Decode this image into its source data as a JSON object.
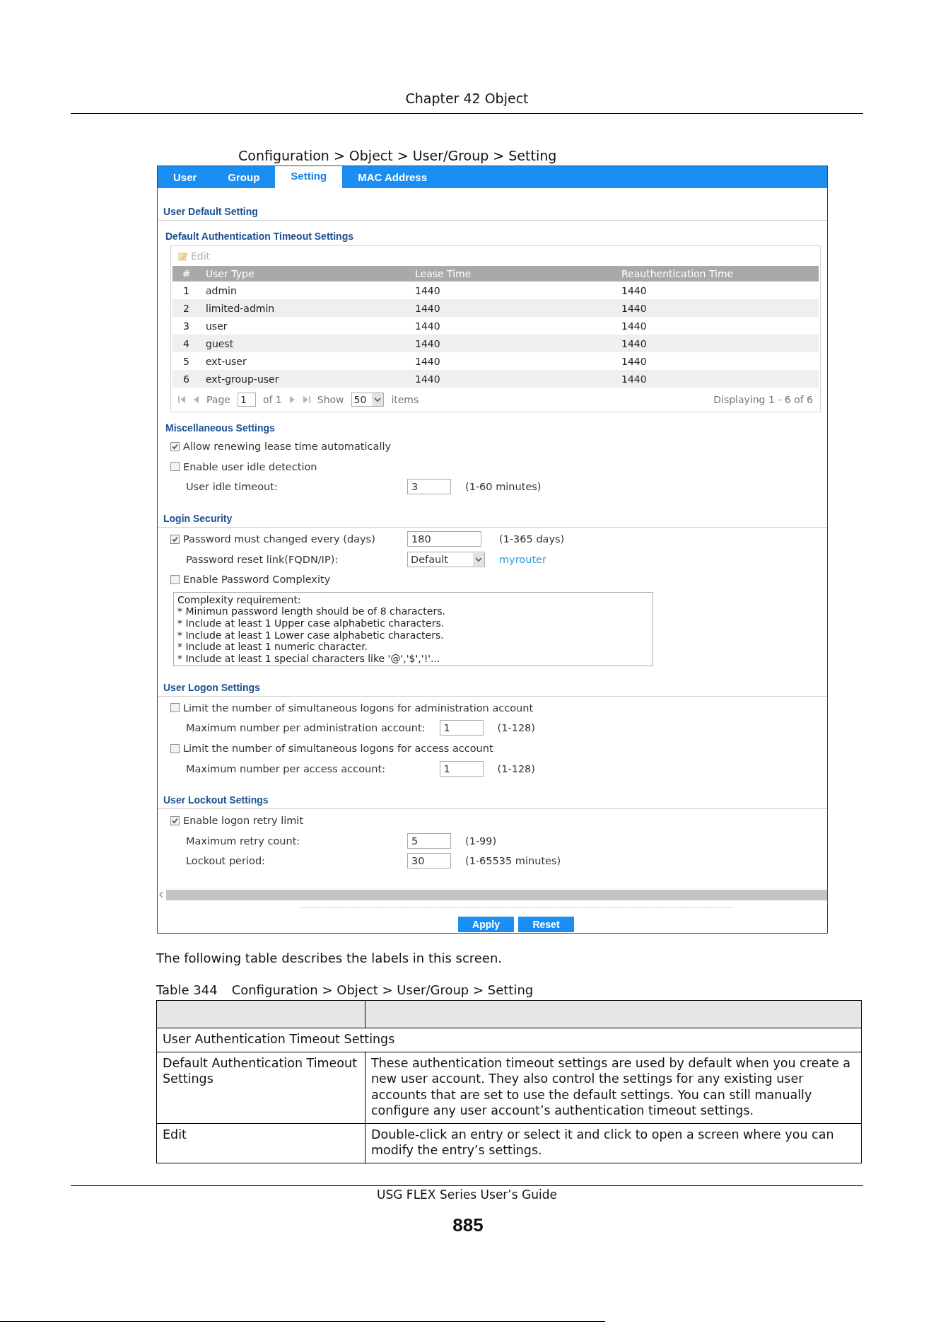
{
  "page_header": {
    "title": "Chapter 42 Object"
  },
  "figure": {
    "caption": "Configuration > Object > User/Group > Setting"
  },
  "screen": {
    "tabs": [
      {
        "label": "User",
        "selected": false
      },
      {
        "label": "Group",
        "selected": false
      },
      {
        "label": "Setting",
        "selected": true
      },
      {
        "label": "MAC Address",
        "selected": false
      }
    ],
    "blocks": [
      {
        "kind": "section",
        "title": "User Default Setting"
      },
      {
        "kind": "subsection",
        "title": "Default Authentication Timeout Settings"
      },
      {
        "kind": "table",
        "edit_button": {
          "label": "Edit",
          "disabled": true
        },
        "columns": [
          "#",
          "User Type",
          "Lease Time",
          "Reauthentication Time"
        ],
        "rows": [
          [
            "1",
            "admin",
            "1440",
            "1440"
          ],
          [
            "2",
            "limited-admin",
            "1440",
            "1440"
          ],
          [
            "3",
            "user",
            "1440",
            "1440"
          ],
          [
            "4",
            "guest",
            "1440",
            "1440"
          ],
          [
            "5",
            "ext-user",
            "1440",
            "1440"
          ],
          [
            "6",
            "ext-group-user",
            "1440",
            "1440"
          ]
        ],
        "pager": {
          "page_label": "Page",
          "page": "1",
          "page_total": "of 1",
          "show_label": "Show",
          "per_page": "50",
          "items_label": "items",
          "summary": "Displaying 1 - 6 of 6"
        }
      },
      {
        "kind": "subsection",
        "title": "Miscellaneous Settings"
      },
      {
        "kind": "group",
        "rows": [
          {
            "kind": "checkbox",
            "label": "Allow renewing lease time automatically",
            "checked": true
          },
          {
            "kind": "checkbox",
            "label": "Enable user idle detection",
            "checked": false
          },
          {
            "kind": "field",
            "label": "User idle timeout:",
            "value": "3",
            "hint": "(1-60 minutes)"
          }
        ]
      },
      {
        "kind": "section",
        "title": "Login Security"
      },
      {
        "kind": "group",
        "rows": [
          {
            "kind": "checkbox",
            "label": "Password must changed every (days)",
            "checked": true,
            "value": "180",
            "hint": "(1-365 days)"
          },
          {
            "kind": "select",
            "label": "Password reset link(FQDN/IP):",
            "value": "Default",
            "link": "myrouter"
          },
          {
            "kind": "checkbox",
            "label": "Enable Password Complexity",
            "checked": false
          },
          {
            "kind": "textarea",
            "lines": [
              "Complexity requirement:",
              "* Minimun password length should be of 8 characters.",
              "* Include at least 1 Upper case alphabetic characters.",
              "* Include at least 1 Lower case alphabetic characters.",
              "* Include at least 1 numeric character.",
              "* Include at least 1 special characters like '@','$','!'..."
            ]
          }
        ]
      },
      {
        "kind": "section",
        "title": "User Logon Settings"
      },
      {
        "kind": "group",
        "rows": [
          {
            "kind": "checkbox",
            "label": "Limit the number of simultaneous logons for administration account",
            "checked": false
          },
          {
            "kind": "field",
            "label": "Maximum number per administration account:",
            "value": "1",
            "hint": "(1-128)"
          },
          {
            "kind": "checkbox",
            "label": "Limit the number of simultaneous logons for access account",
            "checked": false
          },
          {
            "kind": "field",
            "label": "Maximum number per access account:",
            "value": "1",
            "hint": "(1-128)"
          }
        ]
      },
      {
        "kind": "section",
        "title": "User Lockout Settings"
      },
      {
        "kind": "group",
        "rows": [
          {
            "kind": "checkbox",
            "label": "Enable logon retry limit",
            "checked": true
          },
          {
            "kind": "field",
            "label": "Maximum retry count:",
            "value": "5",
            "hint": "(1-99)"
          },
          {
            "kind": "field",
            "label": "Lockout period:",
            "value": "30",
            "hint": "(1-65535 minutes)"
          }
        ]
      }
    ],
    "buttons": [
      {
        "label": "Apply"
      },
      {
        "label": "Reset"
      }
    ]
  },
  "intro": "The following table describes the labels in this screen.",
  "table": {
    "number": "Table 344",
    "title": "Configuration > Object > User/Group > Setting",
    "rows": [
      {
        "kind": "group",
        "label": "User Authentication Timeout Settings"
      },
      {
        "kind": "item",
        "label": "Default Authentication Timeout Settings",
        "description": "These authentication timeout settings are used by default when you create a new user account. They also control the settings for any existing user accounts that are set to use the default settings. You can still manually configure any user account’s authentication timeout settings."
      },
      {
        "kind": "item",
        "label": "Edit",
        "description": "Double-click an entry or select it and click to open a screen where you can modify the entry’s settings."
      }
    ]
  },
  "page_footer": {
    "title": "USG FLEX Series User’s Guide",
    "page_number": "885"
  }
}
